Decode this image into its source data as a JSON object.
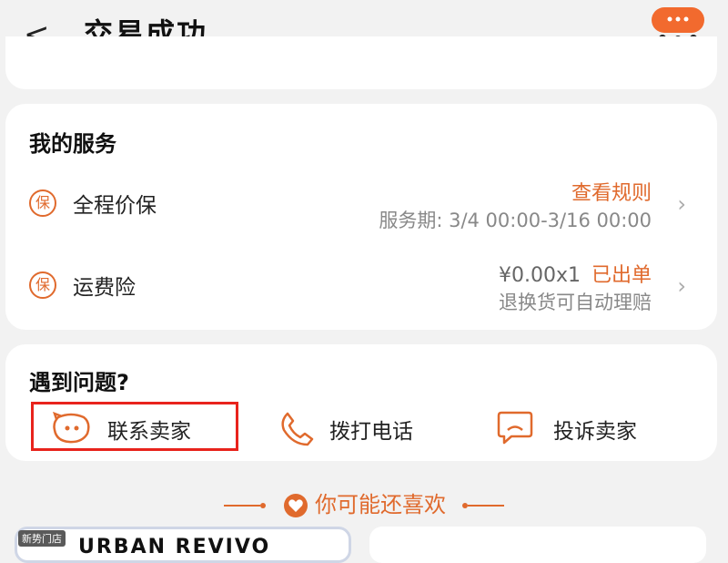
{
  "header": {
    "back_glyph": "<",
    "title": "交易成功",
    "menu_icon": "more-dots-icon",
    "accent": "#f26a2e"
  },
  "services": {
    "title": "我的服务",
    "items": [
      {
        "badge": "保",
        "name": "全程价保",
        "action": "查看规则",
        "detail": "服务期: 3/4 00:00-3/16 00:00"
      },
      {
        "badge": "保",
        "name": "运费险",
        "price_prefix": "¥0.00x1",
        "action": "已出单",
        "detail": "退换货可自动理赔"
      }
    ]
  },
  "issues": {
    "title": "遇到问题?",
    "buttons": [
      {
        "label": "联系卖家",
        "icon": "chat-face-icon"
      },
      {
        "label": "拨打电话",
        "icon": "phone-icon"
      },
      {
        "label": "投诉卖家",
        "icon": "complaint-icon"
      }
    ]
  },
  "recommend": {
    "title": "你可能还喜欢",
    "product_tag": "新势门店",
    "product_brand": "URBAN REVIVO"
  },
  "colors": {
    "accent_orange": "#e06a2d",
    "highlight_red": "#e8231c"
  }
}
